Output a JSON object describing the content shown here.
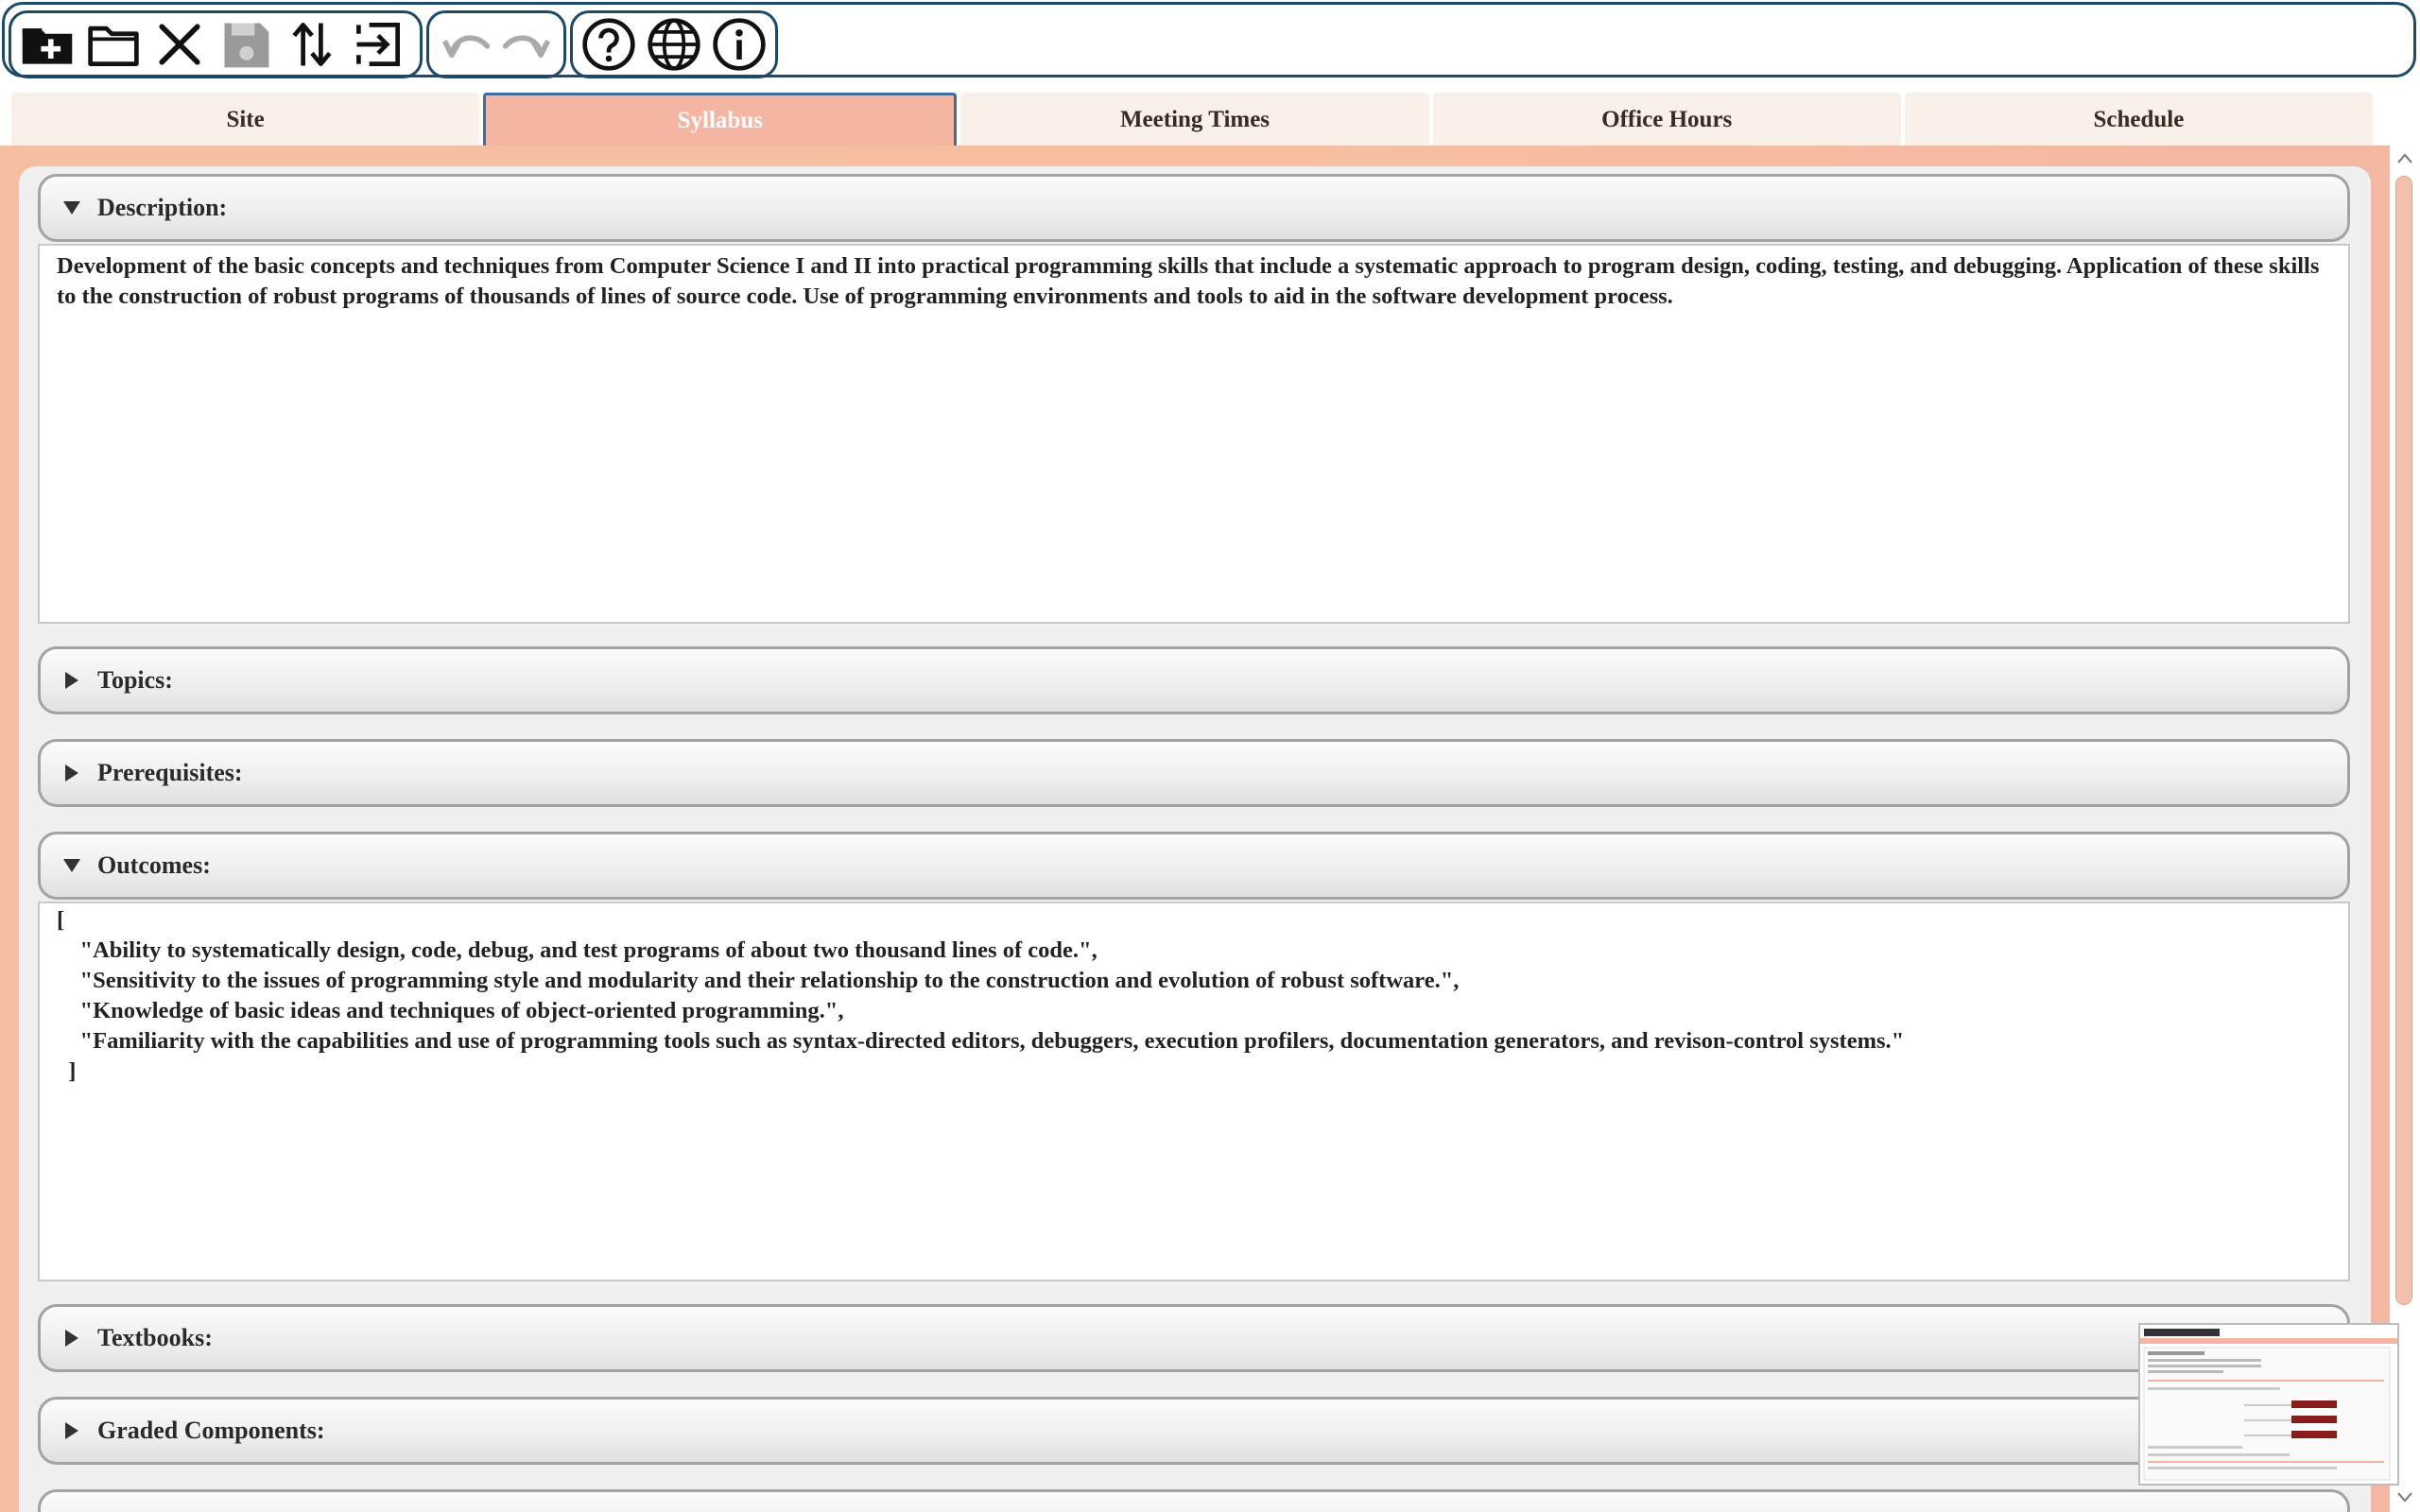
{
  "toolbar": {
    "file_buttons": [
      {
        "icon": "new-folder-plus-icon",
        "name": "new-button"
      },
      {
        "icon": "open-folder-icon",
        "name": "open-button"
      },
      {
        "icon": "close-x-icon",
        "name": "close-button"
      },
      {
        "icon": "save-disk-icon",
        "name": "save-button",
        "disabled": true
      },
      {
        "icon": "sort-arrows-icon",
        "name": "export-button"
      },
      {
        "icon": "exit-arrow-icon",
        "name": "exit-button"
      }
    ],
    "edit_buttons": [
      {
        "icon": "undo-icon",
        "name": "undo-button",
        "disabled": true
      },
      {
        "icon": "redo-icon",
        "name": "redo-button",
        "disabled": true
      }
    ],
    "help_buttons": [
      {
        "icon": "help-question-icon",
        "name": "help-button"
      },
      {
        "icon": "globe-icon",
        "name": "language-button"
      },
      {
        "icon": "info-icon",
        "name": "about-button"
      }
    ]
  },
  "tabs": [
    {
      "label": "Site",
      "active": false
    },
    {
      "label": "Syllabus",
      "active": true
    },
    {
      "label": "Meeting Times",
      "active": false
    },
    {
      "label": "Office Hours",
      "active": false
    },
    {
      "label": "Schedule",
      "active": false
    }
  ],
  "sections": {
    "description": {
      "label": "Description:",
      "expanded": true,
      "text": "Development of the basic concepts and techniques from Computer Science I and II into practical programming skills that include a systematic approach to program design, coding, testing, and debugging. Application of these skills to the construction of robust programs of thousands of lines of source code. Use of programming environments and tools to aid in the software development process."
    },
    "topics": {
      "label": "Topics:",
      "expanded": false
    },
    "prerequisites": {
      "label": "Prerequisites:",
      "expanded": false
    },
    "outcomes": {
      "label": "Outcomes:",
      "expanded": true,
      "text": "[\n    \"Ability to systematically design, code, debug, and test programs of about two thousand lines of code.\",\n    \"Sensitivity to the issues of programming style and modularity and their relationship to the construction and evolution of robust software.\",\n    \"Knowledge of basic ideas and techniques of object-oriented programming.\",\n    \"Familiarity with the capabilities and use of programming tools such as syntax-directed editors, debuggers, execution profilers, documentation generators, and revison-control systems.\"\n  ]"
    },
    "textbooks": {
      "label": "Textbooks:",
      "expanded": false
    },
    "graded_components": {
      "label": "Graded Components:",
      "expanded": false
    }
  },
  "colors": {
    "accent_border": "#1e4a6a",
    "active_tab": "#f4b5a2",
    "background_gradient": "#f7bfa2"
  }
}
